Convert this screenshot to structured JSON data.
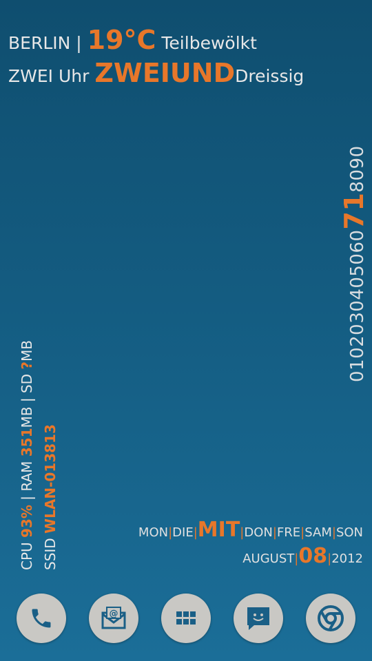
{
  "weather": {
    "city": "BERLIN",
    "separator": "|",
    "temperature": "19°C",
    "condition": "Teilbewölkt"
  },
  "clock": {
    "hour": "ZWEI",
    "uhr": "Uhr",
    "minutes_big": "ZWEIUND",
    "minutes_tail": "Dreissig"
  },
  "minute_scale": {
    "before": "0102030405060",
    "highlight": "71",
    "after": "8090"
  },
  "system": {
    "cpu_label": "CPU",
    "cpu_value": "93%",
    "ram_label": "| RAM",
    "ram_value": "351",
    "ram_unit": "MB | SD",
    "sd_value": "?",
    "sd_unit": "MB",
    "ssid_label": "SSID",
    "ssid_value": "WLAN-013813"
  },
  "weekdays": {
    "mon": "MON",
    "die": "DIE",
    "mit": "MIT",
    "don": "DON",
    "fre": "FRE",
    "sam": "SAM",
    "son": "SON",
    "sep": "|"
  },
  "date": {
    "month": "AUGUST",
    "day": "08",
    "year": "2012",
    "sep": "|"
  },
  "dock": {
    "items": [
      "phone-icon",
      "email-icon",
      "apps-grid-icon",
      "messaging-icon",
      "chrome-browser-icon"
    ]
  },
  "colors": {
    "accent": "#e8772a",
    "background_top": "#0f4e6f",
    "background_bottom": "#1b6e98",
    "dock_button": "#c9c8c4",
    "dock_icon": "#1a5f86"
  }
}
